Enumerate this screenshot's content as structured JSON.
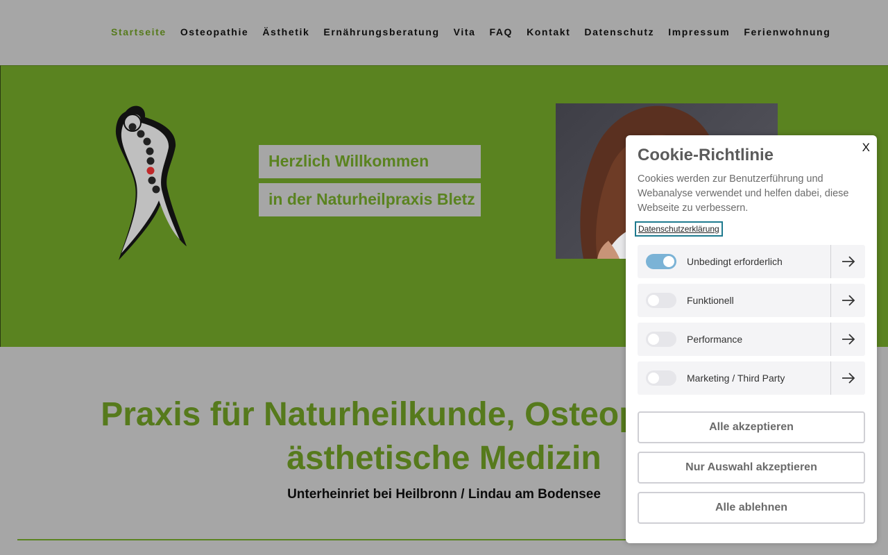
{
  "nav": {
    "items": [
      {
        "label": "Startseite",
        "active": true
      },
      {
        "label": "Osteopathie"
      },
      {
        "label": "Ästhetik"
      },
      {
        "label": "Ernährungsberatung"
      },
      {
        "label": "Vita"
      },
      {
        "label": "FAQ"
      },
      {
        "label": "Kontakt"
      },
      {
        "label": "Datenschutz"
      },
      {
        "label": "Impressum"
      },
      {
        "label": "Ferienwohnung"
      }
    ]
  },
  "hero": {
    "welcome_line1": "Herzlich Willkommen",
    "welcome_line2": "in der Naturheilpraxis Bletz",
    "logo_icon": "spine-figure-logo",
    "portrait_icon": "portrait-photo"
  },
  "main": {
    "title_line1": "Praxis für Naturheilkunde, Osteopathie und",
    "title_line2": "ästhetische Medizin",
    "subtitle": "Unterheinriet bei Heilbronn / Lindau am Bodensee"
  },
  "cookie": {
    "close_label": "X",
    "title": "Cookie-Richtlinie",
    "text": "Cookies werden zur Benutzerführung und Webanalyse verwendet und helfen dabei, diese Webseite zu verbessern.",
    "privacy_link": "Datenschutzerklärung",
    "categories": [
      {
        "label": "Unbedingt erforderlich",
        "enabled": true
      },
      {
        "label": "Funktionell",
        "enabled": false
      },
      {
        "label": "Performance",
        "enabled": false
      },
      {
        "label": "Marketing / Third Party",
        "enabled": false
      }
    ],
    "accept_all": "Alle akzeptieren",
    "accept_selection": "Nur Auswahl akzeptieren",
    "reject_all": "Alle ablehnen"
  },
  "colors": {
    "brand_green": "#5a8320",
    "nav_active": "#567a1c",
    "toggle_on": "#7bb3d6",
    "focus_ring": "#1e7a8e"
  }
}
